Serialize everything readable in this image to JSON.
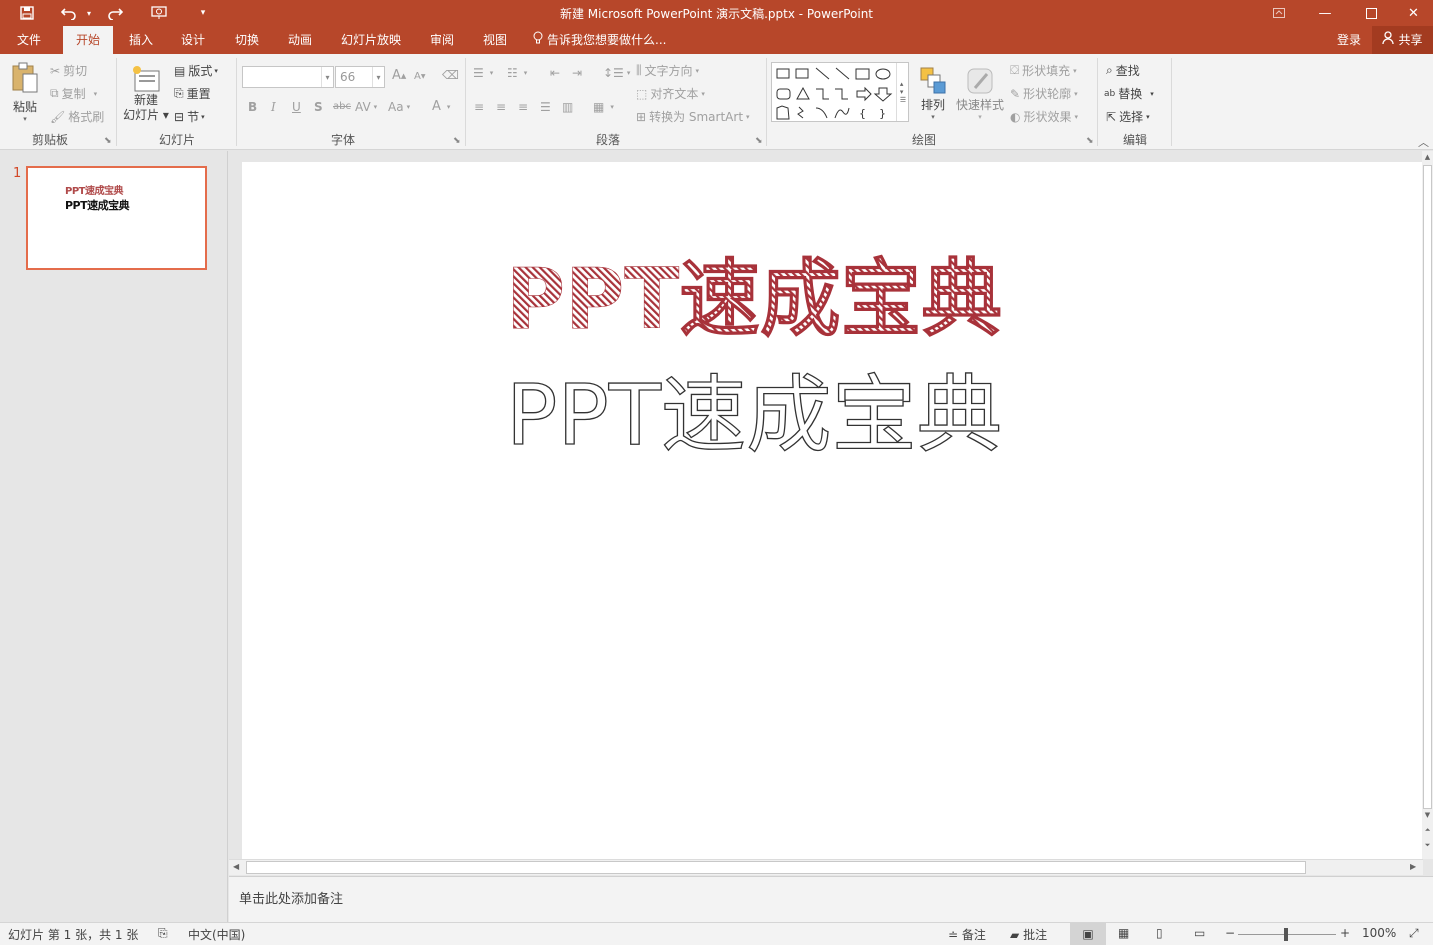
{
  "titlebar": {
    "title": "新建 Microsoft PowerPoint 演示文稿.pptx - PowerPoint",
    "qat": {
      "save_icon": "save-icon",
      "undo_icon": "undo-icon",
      "redo_icon": "redo-icon",
      "present_icon": "start-from-beginning-icon"
    },
    "window": {
      "ribbon_options": "ribbon-display-options-icon",
      "minimize": "minimize-icon",
      "maximize": "maximize-icon",
      "close": "close-icon"
    }
  },
  "tabs": [
    {
      "label": "文件"
    },
    {
      "label": "开始",
      "active": true
    },
    {
      "label": "插入"
    },
    {
      "label": "设计"
    },
    {
      "label": "切换"
    },
    {
      "label": "动画"
    },
    {
      "label": "幻灯片放映"
    },
    {
      "label": "审阅"
    },
    {
      "label": "视图"
    }
  ],
  "tell_me": "告诉我您想要做什么...",
  "login": "登录",
  "share": "共享",
  "ribbon": {
    "clipboard": {
      "label": "剪贴板",
      "paste": "粘贴",
      "cut": "剪切",
      "copy": "复制",
      "format_painter": "格式刷"
    },
    "slides": {
      "label": "幻灯片",
      "new_slide_1": "新建",
      "new_slide_2": "幻灯片",
      "layout": "版式",
      "reset": "重置",
      "section": "节"
    },
    "font": {
      "label": "字体",
      "font_name": "",
      "font_size": "66",
      "bold": "B",
      "italic": "I",
      "underline": "U",
      "shadow": "S",
      "strike": "abc",
      "spacing": "AV",
      "case": "Aa",
      "color": "A",
      "grow": "A",
      "shrink": "A"
    },
    "paragraph": {
      "label": "段落",
      "text_direction": "文字方向",
      "align_text": "对齐文本",
      "smartart": "转换为 SmartArt"
    },
    "drawing": {
      "label": "绘图",
      "arrange": "排列",
      "quick_styles": "快速样式",
      "shape_fill": "形状填充",
      "shape_outline": "形状轮廓",
      "shape_effects": "形状效果"
    },
    "editing": {
      "label": "编辑",
      "find": "查找",
      "replace": "替换",
      "select": "选择"
    }
  },
  "thumbnail": {
    "number": "1",
    "line1": "PPT速成宝典",
    "line2": "PPT速成宝典"
  },
  "slide": {
    "line1": "PPT速成宝典",
    "line2": "PPT速成宝典",
    "colors": {
      "hatch": "#a8323a",
      "outline": "#333333"
    }
  },
  "notes_placeholder": "单击此处添加备注",
  "status": {
    "slide_info": "幻灯片 第 1 张，共 1 张",
    "language": "中文(中国)",
    "notes": "备注",
    "comments": "批注",
    "zoom": "100%"
  }
}
